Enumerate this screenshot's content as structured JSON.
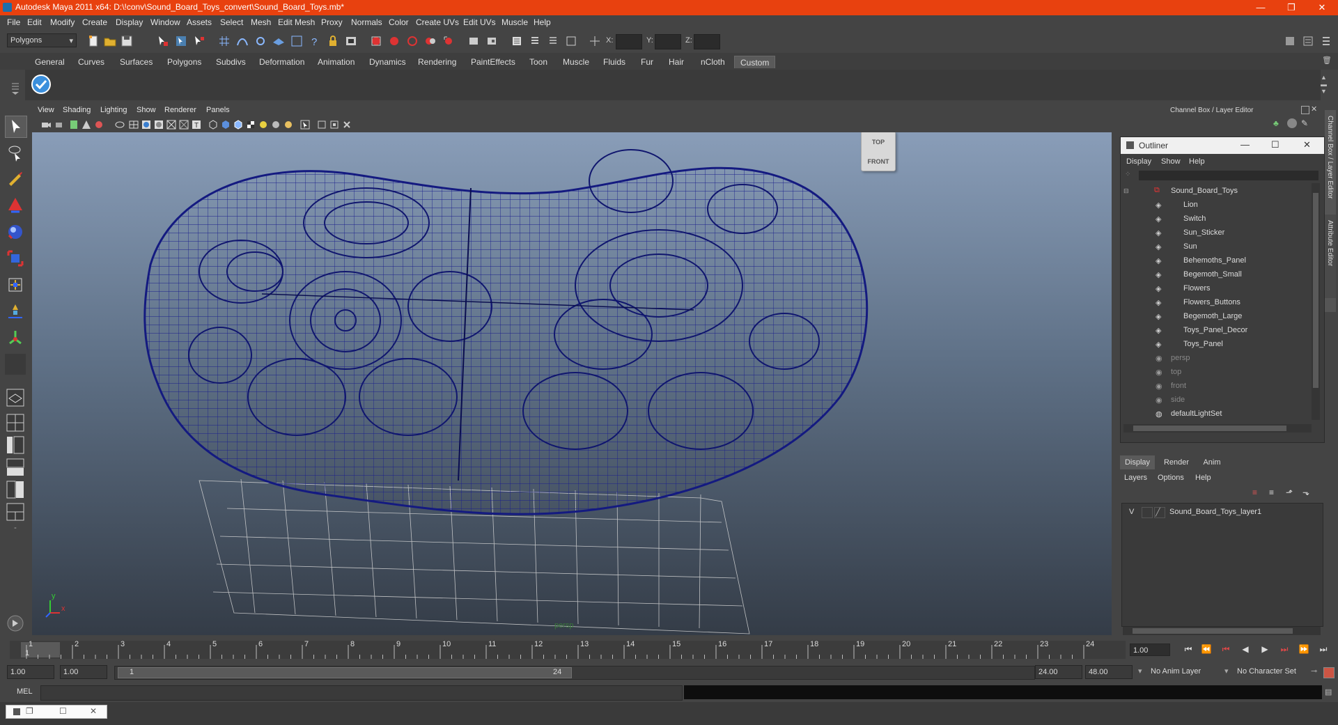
{
  "window": {
    "title": "Autodesk Maya 2011 x64: D:\\!conv\\Sound_Board_Toys_convert\\Sound_Board_Toys.mb*",
    "minimize": "—",
    "maximize": "❐",
    "close": "✕"
  },
  "menu": [
    "File",
    "Edit",
    "Modify",
    "Create",
    "Display",
    "Window",
    "Assets",
    "Select",
    "Mesh",
    "Edit Mesh",
    "Proxy",
    "Normals",
    "Color",
    "Create UVs",
    "Edit UVs",
    "Muscle",
    "Help"
  ],
  "status_line": {
    "mode_select": "Polygons",
    "x_label": "X:",
    "y_label": "Y:",
    "z_label": "Z:"
  },
  "shelf_tabs": [
    "General",
    "Curves",
    "Surfaces",
    "Polygons",
    "Subdivs",
    "Deformation",
    "Animation",
    "Dynamics",
    "Rendering",
    "PaintEffects",
    "Toon",
    "Muscle",
    "Fluids",
    "Fur",
    "Hair",
    "nCloth",
    "Custom"
  ],
  "shelf_active": "Custom",
  "viewport": {
    "menu": [
      "View",
      "Shading",
      "Lighting",
      "Show",
      "Renderer",
      "Panels"
    ],
    "camera_label": "persp",
    "viewcube_top": "TOP",
    "viewcube_front": "FRONT",
    "axis_x": "x",
    "axis_y": "y"
  },
  "channel_box": {
    "title": "Channel Box / Layer Editor",
    "side_tab_1": "Channel Box / Layer Editor",
    "side_tab_2": "Attribute Editor"
  },
  "outliner": {
    "title": "Outliner",
    "menu": [
      "Display",
      "Show",
      "Help"
    ],
    "root": "Sound_Board_Toys",
    "children": [
      "Lion",
      "Switch",
      "Sun_Sticker",
      "Sun",
      "Behemoths_Panel",
      "Begemoth_Small",
      "Flowers",
      "Flowers_Buttons",
      "Begemoth_Large",
      "Toys_Panel_Decor",
      "Toys_Panel"
    ],
    "cameras": [
      "persp",
      "top",
      "front",
      "side"
    ],
    "sets": [
      "defaultLightSet"
    ]
  },
  "layer_editor": {
    "tabs": [
      "Display",
      "Render",
      "Anim"
    ],
    "active_tab": "Display",
    "menu": [
      "Layers",
      "Options",
      "Help"
    ],
    "layer_visibility": "V",
    "layer_name": "Sound_Board_Toys_layer1"
  },
  "time_slider": {
    "ticks": [
      "1",
      "2",
      "3",
      "4",
      "5",
      "6",
      "7",
      "8",
      "9",
      "10",
      "11",
      "12",
      "13",
      "14",
      "15",
      "16",
      "17",
      "18",
      "19",
      "20",
      "21",
      "22",
      "23",
      "24"
    ],
    "current_frame": "1.00"
  },
  "range_slider": {
    "start_time": "1.00",
    "playback_start": "1.00",
    "range_start_label": "1",
    "range_end_label": "24",
    "playback_end": "24.00",
    "end_time": "48.00",
    "anim_layer": "No Anim Layer",
    "character_set": "No Character Set"
  },
  "command_line": {
    "label": "MEL"
  }
}
